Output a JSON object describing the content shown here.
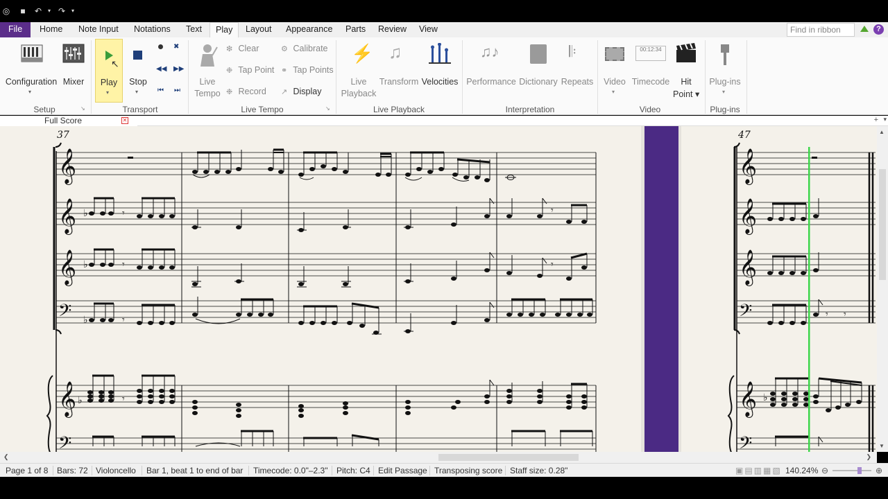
{
  "menu": {
    "file": "File",
    "tabs": [
      "Home",
      "Note Input",
      "Notations",
      "Text",
      "Play",
      "Layout",
      "Appearance",
      "Parts",
      "Review",
      "View"
    ],
    "active_tab": "Play",
    "find_placeholder": "Find in ribbon"
  },
  "ribbon": {
    "setup": {
      "configuration": "Configuration",
      "mixer": "Mixer",
      "group": "Setup"
    },
    "transport": {
      "play": "Play",
      "stop": "Stop",
      "group": "Transport"
    },
    "live_tempo": {
      "live_tempo": "Live Tempo",
      "clear": "Clear",
      "tap_point": "Tap Point",
      "record": "Record",
      "calibrate": "Calibrate",
      "tap_points": "Tap Points",
      "display": "Display",
      "group": "Live Tempo"
    },
    "live_playback": {
      "live_playback": "Live Playback",
      "transform": "Transform",
      "velocities": "Velocities",
      "group": "Live Playback"
    },
    "interpretation": {
      "performance": "Performance",
      "dictionary": "Dictionary",
      "repeats": "Repeats",
      "group": "Interpretation"
    },
    "video": {
      "video": "Video",
      "timecode": "Timecode",
      "hit_point": "Hit Point",
      "group": "Video"
    },
    "plugins": {
      "plugins": "Plug-ins",
      "group": "Plug-ins"
    }
  },
  "document": {
    "tab": "Full Score"
  },
  "score": {
    "bar_left": "37",
    "bar_right": "47",
    "timecode_icon": "00:12:34"
  },
  "status": {
    "page": "Page 1 of 8",
    "bars": "Bars: 72",
    "instrument": "Violoncello",
    "position": "Bar 1, beat 1 to end of bar",
    "timecode": "Timecode: 0.0\"–2.3\"",
    "pitch": "Pitch: C4",
    "mode": "Edit Passage",
    "transposing": "Transposing score",
    "staff_size": "Staff size: 0.28\"",
    "zoom": "140.24%"
  },
  "colors": {
    "accent": "#5b2d8a",
    "playhead": "#3dd64b",
    "play_highlight": "#fff3a6"
  }
}
